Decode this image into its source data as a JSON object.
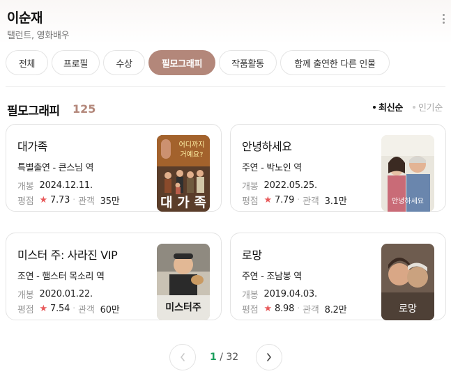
{
  "person": {
    "name": "이순재",
    "subtitle": "탤런트, 영화배우"
  },
  "tabs": [
    {
      "label": "전체",
      "active": false
    },
    {
      "label": "프로필",
      "active": false
    },
    {
      "label": "수상",
      "active": false
    },
    {
      "label": "필모그래피",
      "active": true
    },
    {
      "label": "작품활동",
      "active": false
    },
    {
      "label": "함께 출연한 다른 인물",
      "active": false
    }
  ],
  "section": {
    "title": "필모그래피",
    "count": "125",
    "sort": [
      {
        "label": "최신순",
        "active": true
      },
      {
        "label": "인기순",
        "active": false
      }
    ]
  },
  "labels": {
    "release": "개봉",
    "rating": "평점",
    "audience": "관객"
  },
  "films": [
    {
      "title": "대가족",
      "role": "특별출연 - 큰스님 역",
      "release": "2024.12.11.",
      "rating": "7.73",
      "audience": "35만",
      "poster_icon": "poster-daegajok",
      "poster_text": "대 가 족"
    },
    {
      "title": "안녕하세요",
      "role": "주연 - 박노인 역",
      "release": "2022.05.25.",
      "rating": "7.79",
      "audience": "3.1만",
      "poster_icon": "poster-annyeonghaseyo",
      "poster_text": "안녕하세요"
    },
    {
      "title": "미스터 주: 사라진 VIP",
      "role": "조연 - 햄스터 목소리 역",
      "release": "2020.01.22.",
      "rating": "7.54",
      "audience": "60만",
      "poster_icon": "poster-mister-ju",
      "poster_text": "미스터주"
    },
    {
      "title": "로망",
      "role": "주연 - 조남봉 역",
      "release": "2019.04.03.",
      "rating": "8.98",
      "audience": "8.2만",
      "poster_icon": "poster-romang",
      "poster_text": "로망"
    }
  ],
  "pagination": {
    "current": "1",
    "separator": "/",
    "total": "32"
  },
  "colors": {
    "accent": "#b3877a",
    "star": "#e8595a",
    "page_current": "#1a9e5c"
  }
}
